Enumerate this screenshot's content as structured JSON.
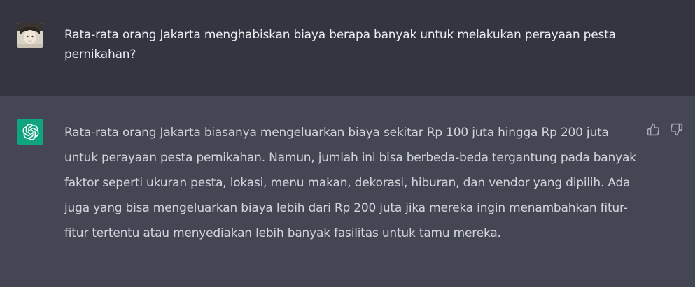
{
  "conversation": {
    "user_message": {
      "avatar_icon": "user-avatar-photo",
      "text": "Rata-rata orang Jakarta menghabiskan biaya berapa banyak untuk melakukan perayaan pesta pernikahan?"
    },
    "assistant_message": {
      "avatar_icon": "openai-logo-icon",
      "avatar_color": "#10a37f",
      "text": "Rata-rata orang Jakarta biasanya mengeluarkan biaya sekitar Rp 100 juta hingga Rp 200 juta untuk perayaan pesta pernikahan. Namun, jumlah ini bisa berbeda-beda tergantung pada banyak faktor seperti ukuran pesta, lokasi, menu makan, dekorasi, hiburan, dan vendor yang dipilih. Ada juga yang bisa mengeluarkan biaya lebih dari Rp 200 juta jika mereka ingin menambahkan fitur-fitur tertentu atau menyediakan lebih banyak fasilitas untuk tamu mereka.",
      "feedback": {
        "like_icon": "thumbs-up-icon",
        "dislike_icon": "thumbs-down-icon"
      }
    }
  },
  "colors": {
    "user_bg": "#343541",
    "assistant_bg": "#444654",
    "user_text": "#ececf1",
    "assistant_text": "#d1d5db",
    "accent": "#10a37f"
  }
}
